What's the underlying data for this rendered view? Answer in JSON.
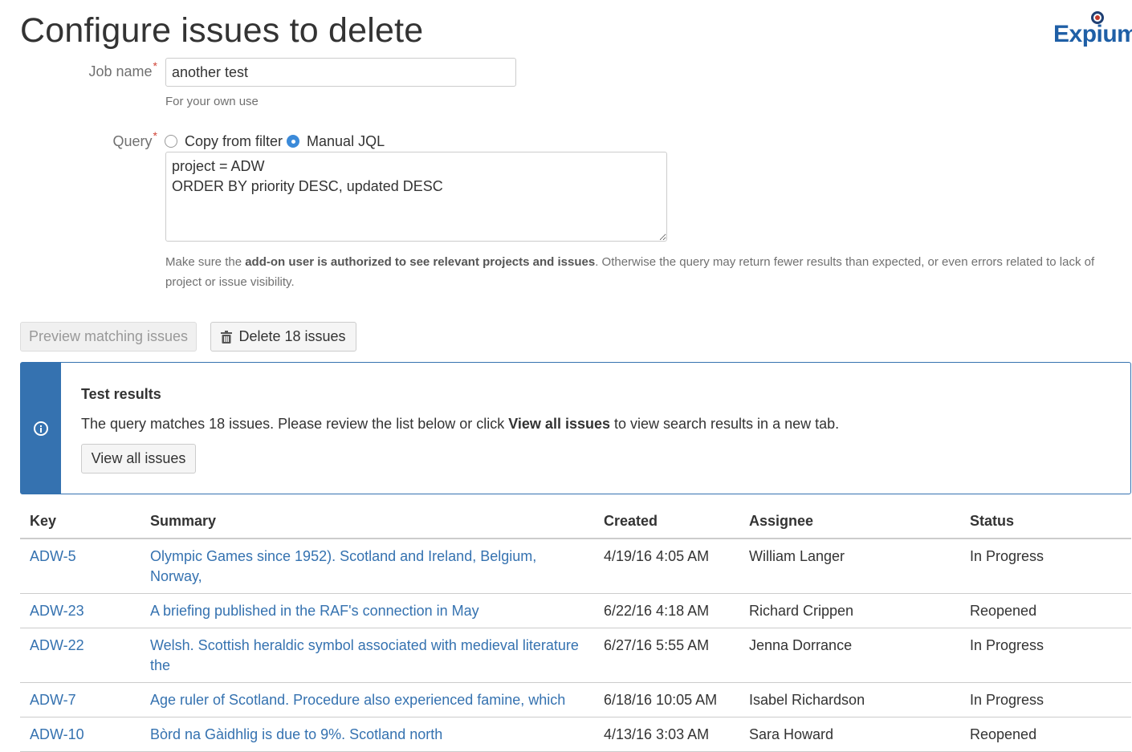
{
  "page_title": "Configure issues to delete",
  "logo": {
    "text": "Expium"
  },
  "job": {
    "label": "Job name",
    "required_mark": "*",
    "value": "another test",
    "help": "For your own use"
  },
  "query": {
    "label": "Query",
    "required_mark": "*",
    "options": [
      {
        "label": "Copy from filter",
        "selected": false
      },
      {
        "label": "Manual JQL",
        "selected": true
      }
    ],
    "jql": "project = ADW\nORDER BY priority DESC, updated DESC",
    "note_prefix": "Make sure the ",
    "note_bold": "add-on user is authorized to see relevant projects and issues",
    "note_suffix": ". Otherwise the query may return fewer results than expected, or even errors related to lack of project or issue visibility."
  },
  "actions": {
    "preview_label": "Preview matching issues",
    "delete_label": "Delete 18 issues"
  },
  "results_panel": {
    "title": "Test results",
    "msg_prefix": "The query matches 18 issues. Please review the list below or click ",
    "msg_bold": "View all issues",
    "msg_suffix": " to view search results in a new tab.",
    "view_all_label": "View all issues",
    "accent_color": "#3572b0"
  },
  "table": {
    "headers": {
      "key": "Key",
      "summary": "Summary",
      "created": "Created",
      "assignee": "Assignee",
      "status": "Status"
    },
    "rows": [
      {
        "key": "ADW-5",
        "summary": "Olympic Games since 1952). Scotland and Ireland, Belgium, Norway,",
        "created": "4/19/16 4:05 AM",
        "assignee": "William Langer",
        "status": "In Progress"
      },
      {
        "key": "ADW-23",
        "summary": "A briefing published in the RAF's connection in May",
        "created": "6/22/16 4:18 AM",
        "assignee": "Richard Crippen",
        "status": "Reopened"
      },
      {
        "key": "ADW-22",
        "summary": "Welsh. Scottish heraldic symbol associated with medieval literature the",
        "created": "6/27/16 5:55 AM",
        "assignee": "Jenna Dorrance",
        "status": "In Progress"
      },
      {
        "key": "ADW-7",
        "summary": "Age ruler of Scotland. Procedure also experienced famine, which",
        "created": "6/18/16 10:05 AM",
        "assignee": "Isabel Richardson",
        "status": "In Progress"
      },
      {
        "key": "ADW-10",
        "summary": "Bòrd na Gàidhlig is due to 9%. Scotland north",
        "created": "4/13/16 3:03 AM",
        "assignee": "Sara Howard",
        "status": "Reopened"
      }
    ]
  },
  "colors": {
    "link": "#3572b0",
    "required": "#d04437",
    "radio_selected": "#3b8ad9"
  }
}
